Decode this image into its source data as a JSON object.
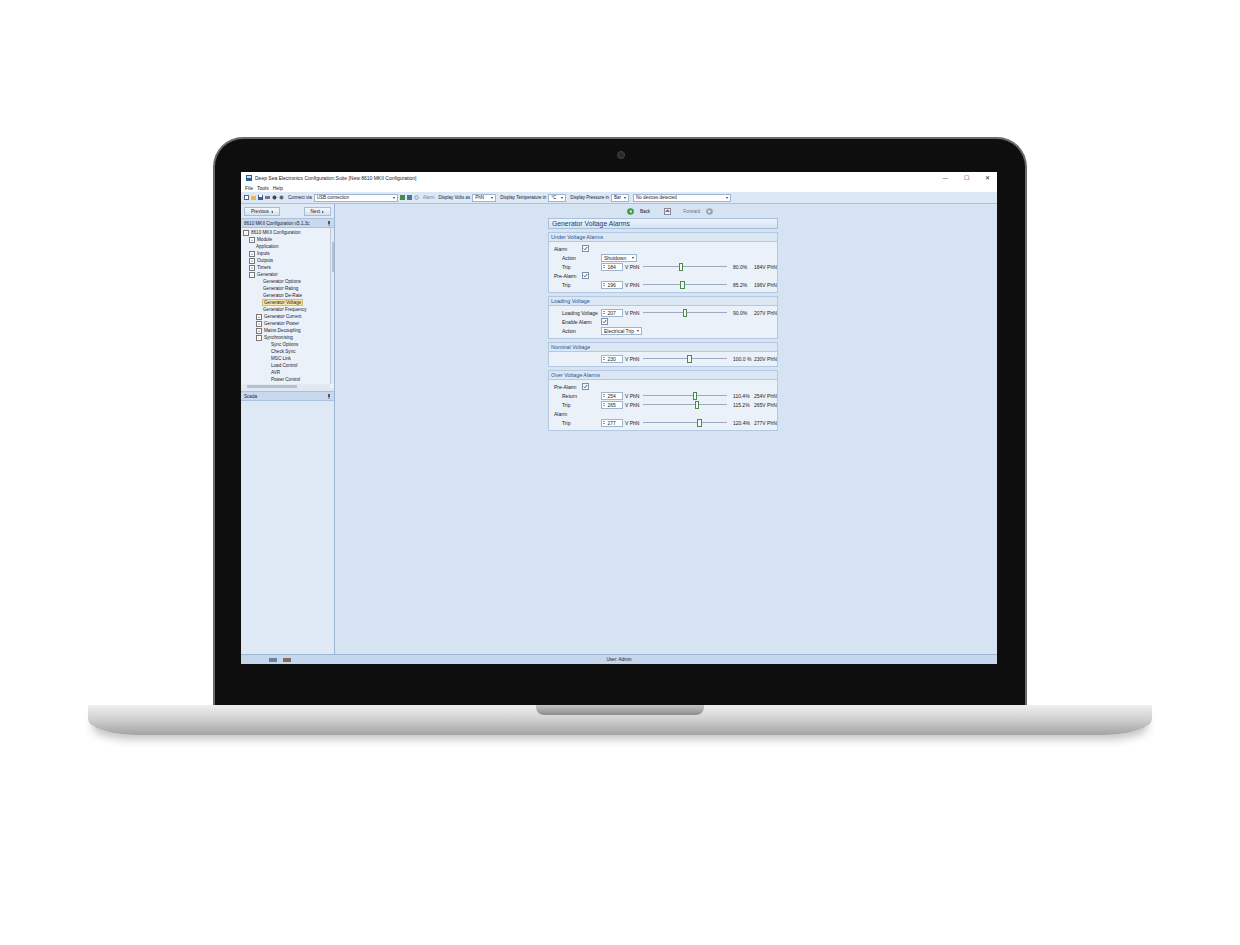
{
  "window": {
    "title": "Deep Sea Electronics Configuration Suite [New 8610 MKII Configuration]",
    "controls": [
      "—",
      "☐",
      "✕"
    ]
  },
  "menu": [
    "File",
    "Tools",
    "Help"
  ],
  "toolbar": {
    "connect_label": "Connect via",
    "connect_value": "USB connection",
    "alarm": "Alarm",
    "volts_label": "Display Volts as",
    "volts_value": "PhN",
    "temp_label": "Display Temperature in",
    "temp_value": "°C",
    "pressure_label": "Display Pressure in",
    "pressure_value": "Bar",
    "device_value": "No devices detected"
  },
  "nav": {
    "previous": "Previous",
    "next": "Next",
    "back": "Back",
    "forward": "Forward"
  },
  "tree": {
    "title": "8610 MKII Configuration v5.1.3c",
    "items": [
      {
        "label": "8610 MKII Configuration",
        "depth": 0,
        "toggle": "-",
        "selected": false
      },
      {
        "label": "Module",
        "depth": 1,
        "toggle": "+",
        "selected": false
      },
      {
        "label": "Application",
        "depth": 1,
        "toggle": "",
        "selected": false
      },
      {
        "label": "Inputs",
        "depth": 1,
        "toggle": "+",
        "selected": false
      },
      {
        "label": "Outputs",
        "depth": 1,
        "toggle": "+",
        "selected": false
      },
      {
        "label": "Timers",
        "depth": 1,
        "toggle": "+",
        "selected": false
      },
      {
        "label": "Generator",
        "depth": 1,
        "toggle": "-",
        "selected": false
      },
      {
        "label": "Generator Options",
        "depth": 2,
        "toggle": "",
        "selected": false
      },
      {
        "label": "Generator Rating",
        "depth": 2,
        "toggle": "",
        "selected": false
      },
      {
        "label": "Generator De-Rate",
        "depth": 2,
        "toggle": "",
        "selected": false
      },
      {
        "label": "Generator Voltage",
        "depth": 2,
        "toggle": "",
        "selected": true
      },
      {
        "label": "Generator Frequency",
        "depth": 2,
        "toggle": "",
        "selected": false
      },
      {
        "label": "Generator Current",
        "depth": 2,
        "toggle": "+",
        "selected": false
      },
      {
        "label": "Generator Power",
        "depth": 2,
        "toggle": "+",
        "selected": false
      },
      {
        "label": "Mains Decoupling",
        "depth": 2,
        "toggle": "+",
        "selected": false
      },
      {
        "label": "Synchronising",
        "depth": 2,
        "toggle": "-",
        "selected": false
      },
      {
        "label": "Sync Options",
        "depth": 3,
        "toggle": "",
        "selected": false
      },
      {
        "label": "Check Sync",
        "depth": 3,
        "toggle": "",
        "selected": false
      },
      {
        "label": "MSC Link",
        "depth": 3,
        "toggle": "",
        "selected": false
      },
      {
        "label": "Load Control",
        "depth": 3,
        "toggle": "",
        "selected": false
      },
      {
        "label": "AVR",
        "depth": 3,
        "toggle": "",
        "selected": false
      },
      {
        "label": "Power Control",
        "depth": 3,
        "toggle": "",
        "selected": false
      }
    ]
  },
  "scada": "Scada",
  "page": {
    "title": "Generator Voltage Alarms",
    "sections": [
      {
        "title": "Under Voltage Alarms",
        "rows": [
          {
            "kind": "check",
            "group": true,
            "label": "Alarm",
            "checked": true
          },
          {
            "kind": "select",
            "label": "Action",
            "value": "Shutdown"
          },
          {
            "kind": "slider",
            "label": "Trip",
            "value": "184",
            "unit": "V PhN",
            "level": 0.44,
            "percent": "80.0%",
            "reading": "184V PhN"
          },
          {
            "kind": "check",
            "group": true,
            "label": "Pre-Alarm",
            "checked": true
          },
          {
            "kind": "slider",
            "label": "Trip",
            "value": "196",
            "unit": "V PhN",
            "level": 0.46,
            "percent": "85.2%",
            "reading": "196V PhN"
          }
        ]
      },
      {
        "title": "Loading Voltage",
        "rows": [
          {
            "kind": "slider",
            "label": "Loading Voltage",
            "value": "207",
            "unit": "V PhN",
            "level": 0.49,
            "percent": "90.0%",
            "reading": "207V PhN"
          },
          {
            "kind": "check",
            "group": false,
            "label": "Enable Alarm",
            "checked": true
          },
          {
            "kind": "select",
            "label": "Action",
            "value": "Electrical Trip"
          }
        ]
      },
      {
        "title": "Nominal Voltage",
        "rows": [
          {
            "kind": "slider",
            "label": "",
            "value": "230",
            "unit": "V PhN",
            "level": 0.54,
            "percent": "100.0 %",
            "reading": "230V PhN"
          }
        ]
      },
      {
        "title": "Over Voltage Alarms",
        "rows": [
          {
            "kind": "check",
            "group": true,
            "label": "Pre-Alarm",
            "checked": true
          },
          {
            "kind": "slider",
            "label": "Return",
            "value": "254",
            "unit": "V PhN",
            "level": 0.61,
            "percent": "110.4%",
            "reading": "254V PhN"
          },
          {
            "kind": "slider",
            "label": "Trip",
            "value": "265",
            "unit": "V PhN",
            "level": 0.63,
            "percent": "115.2%",
            "reading": "265V PhN"
          },
          {
            "kind": "heading",
            "label": "Alarm"
          },
          {
            "kind": "slider",
            "label": "Trip",
            "value": "277",
            "unit": "V PhN",
            "level": 0.66,
            "percent": "120.4%",
            "reading": "277V PhN"
          }
        ]
      }
    ]
  },
  "status_bar": {
    "user": "User: Admin"
  }
}
